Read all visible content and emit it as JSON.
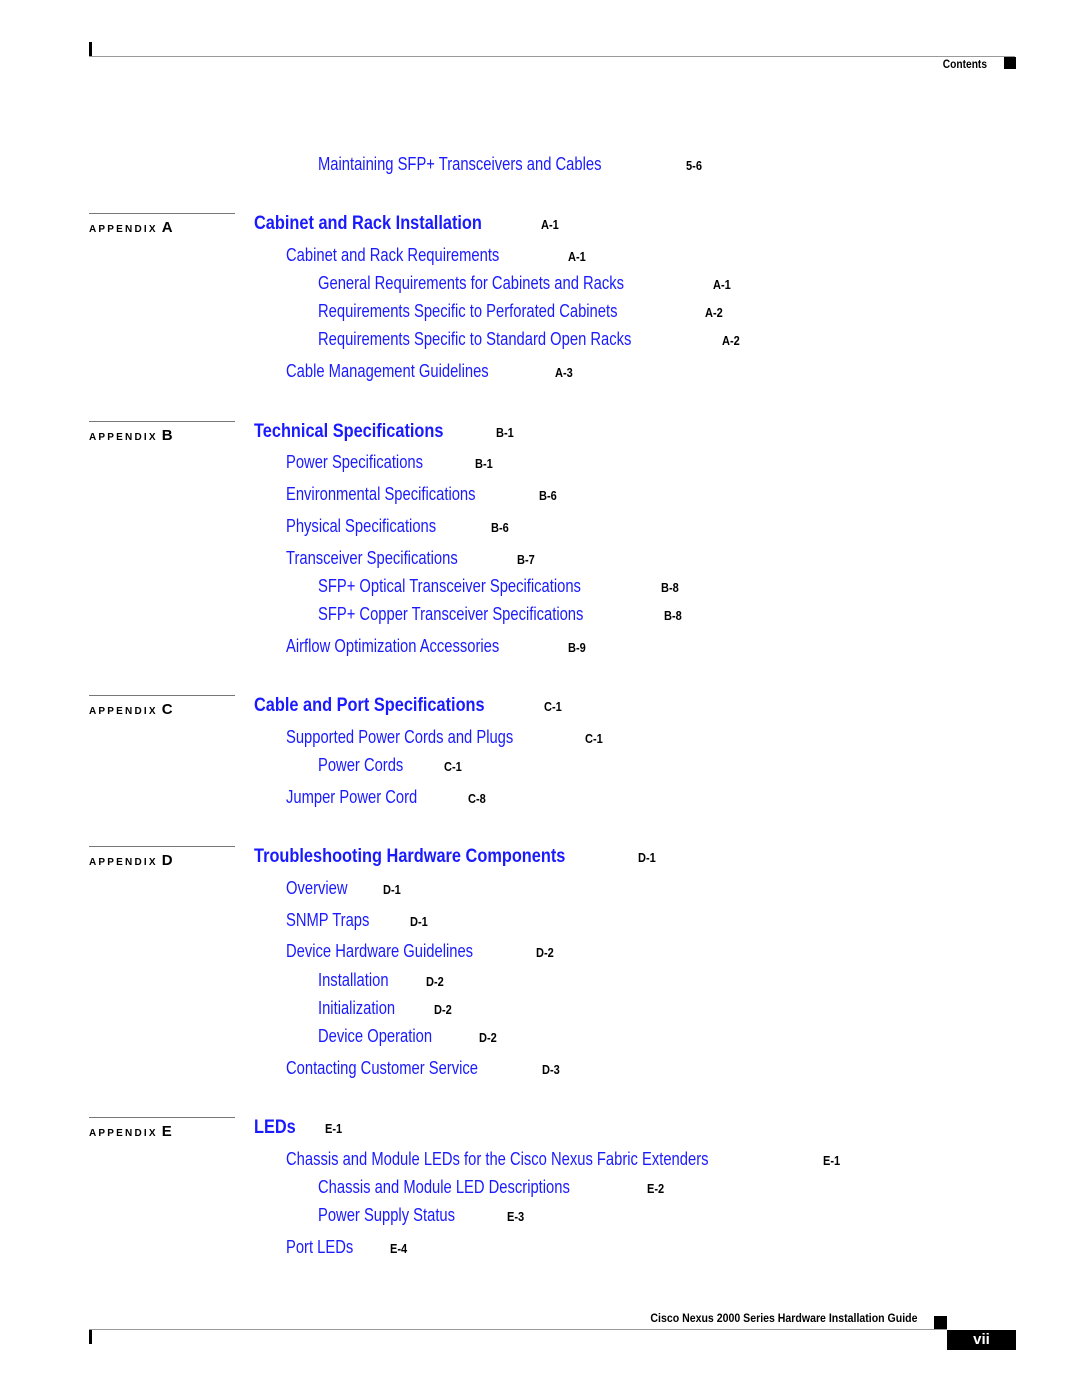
{
  "header": {
    "label": "Contents"
  },
  "footer": {
    "title": "Cisco Nexus 2000 Series Hardware Installation Guide",
    "page_number": "vii"
  },
  "colors": {
    "link": "#1a1aff",
    "text": "#000000"
  },
  "continued_entries": [
    {
      "title": "Maintaining SFP+ Transceivers and Cables",
      "page": "5-6",
      "level": 2
    }
  ],
  "appendices": [
    {
      "label": "APPENDIX",
      "letter": "A",
      "title": "Cabinet and Rack Installation",
      "page": "A-1",
      "entries": [
        {
          "title": "Cabinet and Rack Requirements",
          "page": "A-1",
          "level": 1
        },
        {
          "title": "General Requirements for Cabinets and Racks",
          "page": "A-1",
          "level": 2
        },
        {
          "title": "Requirements Specific to Perforated Cabinets",
          "page": "A-2",
          "level": 2
        },
        {
          "title": "Requirements Specific to Standard Open Racks",
          "page": "A-2",
          "level": 2
        },
        {
          "title": "Cable Management Guidelines",
          "page": "A-3",
          "level": 1
        }
      ]
    },
    {
      "label": "APPENDIX",
      "letter": "B",
      "title": "Technical Specifications",
      "page": "B-1",
      "entries": [
        {
          "title": "Power Specifications",
          "page": "B-1",
          "level": 1
        },
        {
          "title": "Environmental Specifications",
          "page": "B-6",
          "level": 1
        },
        {
          "title": "Physical Specifications",
          "page": "B-6",
          "level": 1
        },
        {
          "title": "Transceiver Specifications",
          "page": "B-7",
          "level": 1
        },
        {
          "title": "SFP+ Optical Transceiver Specifications",
          "page": "B-8",
          "level": 2
        },
        {
          "title": "SFP+ Copper Transceiver Specifications",
          "page": "B-8",
          "level": 2
        },
        {
          "title": "Airflow Optimization Accessories",
          "page": "B-9",
          "level": 1
        }
      ]
    },
    {
      "label": "APPENDIX",
      "letter": "C",
      "title": "Cable and Port Specifications",
      "page": "C-1",
      "entries": [
        {
          "title": "Supported Power Cords and Plugs",
          "page": "C-1",
          "level": 1
        },
        {
          "title": "Power Cords",
          "page": "C-1",
          "level": 2
        },
        {
          "title": "Jumper Power Cord",
          "page": "C-8",
          "level": 1
        }
      ]
    },
    {
      "label": "APPENDIX",
      "letter": "D",
      "title": "Troubleshooting Hardware Components",
      "page": "D-1",
      "entries": [
        {
          "title": "Overview",
          "page": "D-1",
          "level": 1
        },
        {
          "title": "SNMP Traps",
          "page": "D-1",
          "level": 1
        },
        {
          "title": "Device Hardware Guidelines",
          "page": "D-2",
          "level": 1
        },
        {
          "title": "Installation",
          "page": "D-2",
          "level": 2
        },
        {
          "title": "Initialization",
          "page": "D-2",
          "level": 2
        },
        {
          "title": "Device Operation",
          "page": "D-2",
          "level": 2
        },
        {
          "title": "Contacting Customer Service",
          "page": "D-3",
          "level": 1
        }
      ]
    },
    {
      "label": "APPENDIX",
      "letter": "E",
      "title": "LEDs",
      "page": "E-1",
      "entries": [
        {
          "title": "Chassis and Module LEDs for the Cisco Nexus Fabric Extenders",
          "page": "E-1",
          "level": 1
        },
        {
          "title": "Chassis and Module LED Descriptions",
          "page": "E-2",
          "level": 2
        },
        {
          "title": "Power Supply Status",
          "page": "E-3",
          "level": 2
        },
        {
          "title": "Port LEDs",
          "page": "E-4",
          "level": 1
        }
      ]
    }
  ]
}
